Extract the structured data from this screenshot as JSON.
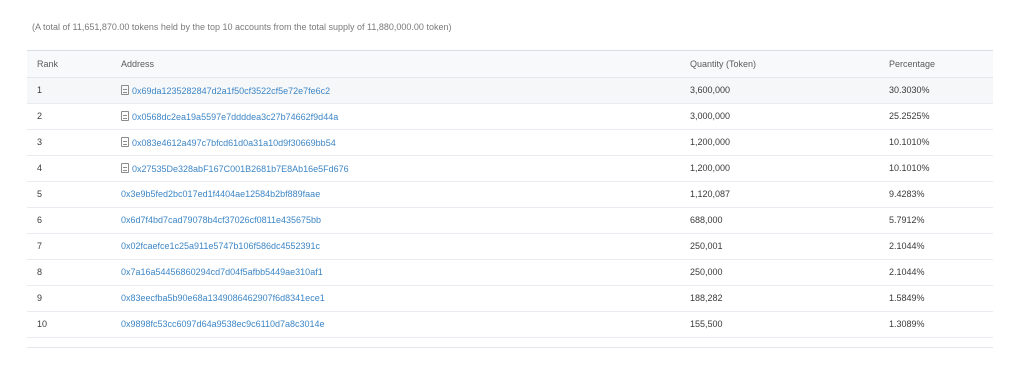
{
  "summary": "(A total of 11,651,870.00 tokens held by the top 10 accounts from the total supply of 11,880,000.00 token)",
  "table": {
    "headers": {
      "rank": "Rank",
      "address": "Address",
      "quantity": "Quantity (Token)",
      "percentage": "Percentage"
    },
    "rows": [
      {
        "rank": "1",
        "address": "0x69da1235282847d2a1f50cf3522cf5e72e7fe6c2",
        "contract": true,
        "quantity": "3,600,000",
        "percentage": "30.3030%"
      },
      {
        "rank": "2",
        "address": "0x0568dc2ea19a5597e7ddddea3c27b74662f9d44a",
        "contract": true,
        "quantity": "3,000,000",
        "percentage": "25.2525%"
      },
      {
        "rank": "3",
        "address": "0x083e4612a497c7bfcd61d0a31a10d9f30669bb54",
        "contract": true,
        "quantity": "1,200,000",
        "percentage": "10.1010%"
      },
      {
        "rank": "4",
        "address": "0x27535De328abF167C001B2681b7E8Ab16e5Fd676",
        "contract": true,
        "quantity": "1,200,000",
        "percentage": "10.1010%"
      },
      {
        "rank": "5",
        "address": "0x3e9b5fed2bc017ed1f4404ae12584b2bf889faae",
        "contract": false,
        "quantity": "1,120,087",
        "percentage": "9.4283%"
      },
      {
        "rank": "6",
        "address": "0x6d7f4bd7cad79078b4cf37026cf0811e435675bb",
        "contract": false,
        "quantity": "688,000",
        "percentage": "5.7912%"
      },
      {
        "rank": "7",
        "address": "0x02fcaefce1c25a911e5747b106f586dc4552391c",
        "contract": false,
        "quantity": "250,001",
        "percentage": "2.1044%"
      },
      {
        "rank": "8",
        "address": "0x7a16a54456860294cd7d04f5afbb5449ae310af1",
        "contract": false,
        "quantity": "250,000",
        "percentage": "2.1044%"
      },
      {
        "rank": "9",
        "address": "0x83eecfba5b90e68a134908646290 7f6d8341ece1",
        "contract": false,
        "quantity": "188,282",
        "percentage": "1.5849%"
      },
      {
        "rank": "10",
        "address": "0x9898fc53cc6097d64a9538ec9c6110d7a8c3014e",
        "contract": false,
        "quantity": "155,500",
        "percentage": "1.3089%"
      }
    ]
  },
  "colors": {
    "link": "#3d86c6",
    "header_bg": "#f7f9fb",
    "highlight_row": "#f6f7f9"
  },
  "icons": {
    "contract": "document-icon"
  }
}
